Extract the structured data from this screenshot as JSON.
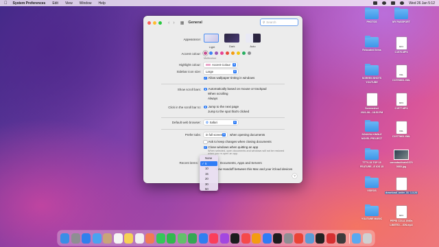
{
  "menubar": {
    "app_name": "System Preferences",
    "items": [
      "Edit",
      "View",
      "Window",
      "Help"
    ],
    "clock": "Wed 26 Jan  5:12"
  },
  "window": {
    "title": "General",
    "search_placeholder": "Search",
    "appearance": {
      "label": "Appearance:",
      "options": [
        "Light",
        "Dark",
        "Auto"
      ],
      "selected": "Light"
    },
    "accent_colour": {
      "label": "Accent colour:",
      "caption": "Multicolour",
      "colors": [
        "#c3508f",
        "#3b82f6",
        "#9b59b6",
        "#e84393",
        "#e74c3c",
        "#f39c12",
        "#f1c40f",
        "#27ae60",
        "#8e8e93"
      ]
    },
    "highlight_colour": {
      "label": "Highlight colour:",
      "value": "Accent Colour"
    },
    "sidebar_icon_size": {
      "label": "Sidebar icon size:",
      "value": "Large"
    },
    "wallpaper_tinting": {
      "label": "Allow wallpaper tinting in windows",
      "checked": true
    },
    "show_scroll_bars": {
      "label": "Show scroll bars:",
      "options": [
        "Automatically based on mouse or trackpad",
        "When scrolling",
        "Always"
      ],
      "selected": 0
    },
    "click_scroll_bar": {
      "label": "Click in the scroll bar to:",
      "options": [
        "Jump to the next page",
        "Jump to the spot that's clicked"
      ],
      "selected": 0
    },
    "default_browser": {
      "label": "Default web browser:",
      "value": "Safari"
    },
    "prefer_tabs": {
      "label": "Prefer tabs:",
      "value": "in full screen",
      "suffix": "when opening documents"
    },
    "ask_keep_changes": {
      "label": "Ask to keep changes when closing documents",
      "checked": false
    },
    "close_windows": {
      "label": "Close windows when quitting an app",
      "checked": true,
      "note_line1": "When selected, open documents and windows will not be restored",
      "note_line2": "when you re-open an app."
    },
    "recent_items": {
      "label": "Recent items:",
      "suffix": "Documents, Apps and Servers"
    },
    "handoff": {
      "label": "Allow Handoff between this Mac and your iCloud devices"
    },
    "help_label": "?"
  },
  "dropdown": {
    "items": [
      "None",
      "5",
      "10",
      "15",
      "20",
      "30",
      "50"
    ],
    "selected": "5"
  },
  "desktop_icons": [
    {
      "label1": "PHOTOS",
      "label2": "",
      "kind": "folder"
    },
    {
      "label1": "MY PASSPORT",
      "label2": "",
      "kind": "folder"
    },
    {
      "label1": "Relocated Items",
      "label2": "",
      "kind": "folder"
    },
    {
      "label1": "C1576.MP4",
      "label2": "",
      "kind": "file",
      "tag": "MP4"
    },
    {
      "label1": "SCREEN SHOTS",
      "label2": "YOUTUBE",
      "kind": "folder"
    },
    {
      "label1": "C1576M01.XML",
      "label2": "",
      "kind": "file",
      "tag": "XML"
    },
    {
      "label1": "Screenshot",
      "label2": "2021-08....18.53 PM",
      "kind": "file",
      "tag": ""
    },
    {
      "label1": "C1577.MP4",
      "label2": "",
      "kind": "file",
      "tag": "MP4"
    },
    {
      "label1": "SOUNYA KINDLE",
      "label2": "NOVEL PROJECT",
      "kind": "folder"
    },
    {
      "label1": "C1577M01.XML",
      "label2": "",
      "kind": "file",
      "tag": "XML"
    },
    {
      "label1": "TTTV-15.TOP 15",
      "label2": "FEATURE...E IOS 15",
      "kind": "folder"
    },
    {
      "label1": "cannotactivate1670",
      "label2": "0669.jpg",
      "kind": "image"
    },
    {
      "label1": "VIDEOS",
      "label2": "",
      "kind": "folder"
    },
    {
      "label1": "download_order_31",
      "label2": "1.3.23",
      "kind": "file",
      "tag": ""
    },
    {
      "label1": "YOUTUBE MUSIC",
      "label2": "",
      "kind": "folder"
    },
    {
      "label1": "PEPSI COLA 1940s",
      "label2": "LIMITED....ION.mp4",
      "kind": "file",
      "tag": "MP4"
    }
  ],
  "dock_apps": [
    {
      "name": "Finder",
      "color": "#3a8ee6"
    },
    {
      "name": "Launchpad",
      "color": "#8e8e93"
    },
    {
      "name": "Safari",
      "color": "#2f80ed"
    },
    {
      "name": "Mail",
      "color": "#4aa3f0"
    },
    {
      "name": "Contacts",
      "color": "#c8a57a"
    },
    {
      "name": "Calendar",
      "color": "#f5f5f5"
    },
    {
      "name": "Notes",
      "color": "#f6d155"
    },
    {
      "name": "Reminders",
      "color": "#f2f2f2"
    },
    {
      "name": "Photos",
      "color": "#f27a54"
    },
    {
      "name": "Messages",
      "color": "#34c759"
    },
    {
      "name": "FaceTime",
      "color": "#30b94d"
    },
    {
      "name": "Maps",
      "color": "#63c06a"
    },
    {
      "name": "Numbers",
      "color": "#34a853"
    },
    {
      "name": "Keynote",
      "color": "#2f7ff0"
    },
    {
      "name": "Music",
      "color": "#fa3e5a"
    },
    {
      "name": "Podcasts",
      "color": "#a347e0"
    },
    {
      "name": "TV",
      "color": "#1c1c1e"
    },
    {
      "name": "News",
      "color": "#f54a4a"
    },
    {
      "name": "Books",
      "color": "#f39c12"
    },
    {
      "name": "App Store",
      "color": "#2d7cf6"
    },
    {
      "name": "Terminal",
      "color": "#1c1c1e"
    },
    {
      "name": "System Preferences",
      "color": "#8e8e93"
    },
    {
      "name": "Chrome",
      "color": "#ea4335"
    },
    {
      "name": "Preview",
      "color": "#5b9bd5"
    },
    {
      "name": "Final Cut Pro",
      "color": "#222222"
    },
    {
      "name": "Photo Booth",
      "color": "#d63031"
    },
    {
      "name": "QuickTime",
      "color": "#3c3c3c"
    },
    {
      "name": "Downloads",
      "color": "#5aa9f0"
    },
    {
      "name": "Trash",
      "color": "#d0d0d0"
    }
  ],
  "accent_selected_color": "#2f7df6"
}
